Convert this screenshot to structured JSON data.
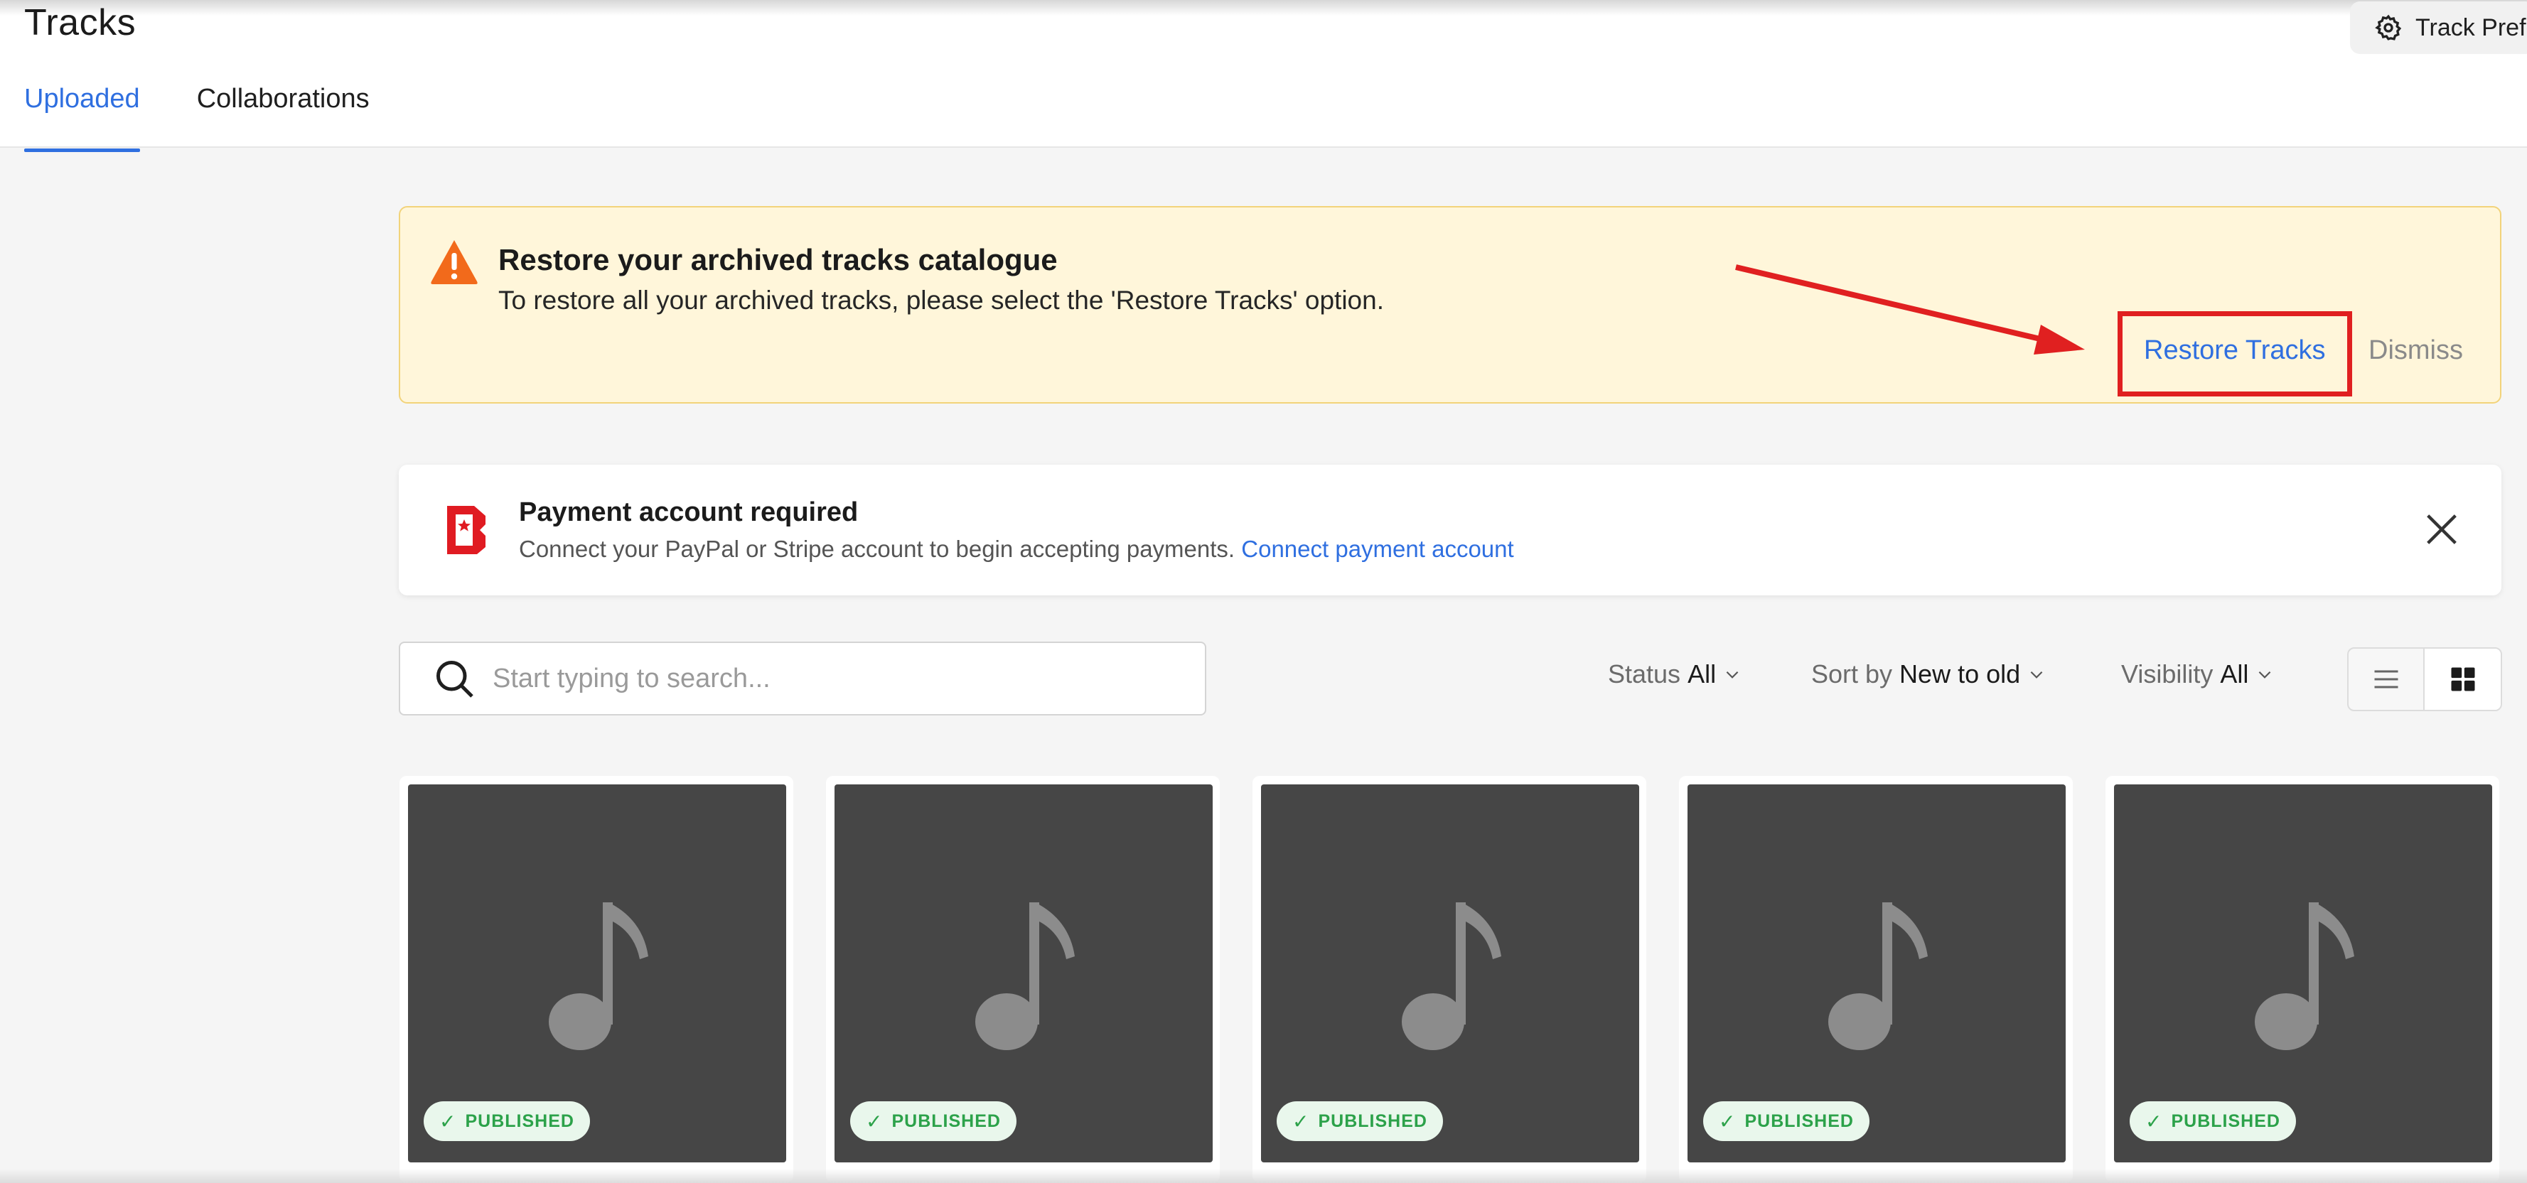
{
  "header": {
    "title": "Tracks",
    "preferences_label": "Track Preferences",
    "preferences_icon": "gear-icon",
    "tabs": [
      {
        "label": "Uploaded",
        "active": true
      },
      {
        "label": "Collaborations",
        "active": false
      }
    ]
  },
  "archive_banner": {
    "icon": "warning-icon",
    "title": "Restore your archived tracks catalogue",
    "description": "To restore all your archived tracks, please select the 'Restore Tracks' option.",
    "restore_label": "Restore Tracks",
    "dismiss_label": "Dismiss"
  },
  "payment_banner": {
    "icon": "brand-logo-icon",
    "title": "Payment account required",
    "description": "Connect your PayPal or Stripe account to begin accepting payments.",
    "link_label": "Connect payment account",
    "close_icon": "close-icon"
  },
  "toolbar": {
    "search_placeholder": "Start typing to search...",
    "filters": [
      {
        "label": "Status",
        "value": "All"
      },
      {
        "label": "Sort by",
        "value": "New to old"
      },
      {
        "label": "Visibility",
        "value": "All"
      }
    ],
    "view_mode": "grid"
  },
  "tracks": [
    {
      "status": "PUBLISHED"
    },
    {
      "status": "PUBLISHED"
    },
    {
      "status": "PUBLISHED"
    },
    {
      "status": "PUBLISHED"
    },
    {
      "status": "PUBLISHED"
    }
  ],
  "colors": {
    "accent": "#2f6fe0",
    "warning_bg": "#fff6da",
    "annotation": "#e02020",
    "published": "#2ca24a"
  }
}
